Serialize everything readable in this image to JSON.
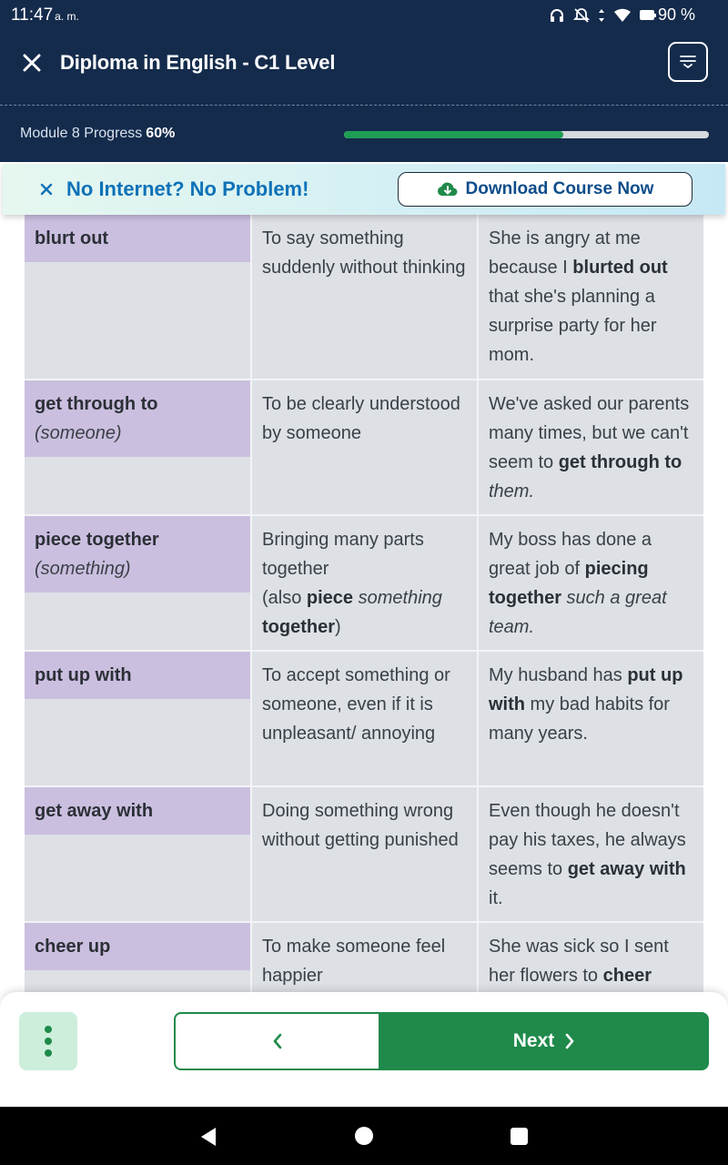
{
  "status_bar": {
    "time": "11:47",
    "ampm": "a. m.",
    "battery": "90 %"
  },
  "header": {
    "course_title": "Diploma in English - C1 Level",
    "progress_label": "Module 8 Progress",
    "progress_percent_text": "60%",
    "progress_value": 0.6
  },
  "banner": {
    "message": "No Internet? No Problem!",
    "download_label": "Download Course Now"
  },
  "table": {
    "rows": [
      {
        "term": "blurt out",
        "term_sub": "",
        "definition": [
          {
            "t": "To say something suddenly without thinking"
          }
        ],
        "example": [
          {
            "t": "She is angry at me because I "
          },
          {
            "t": "blurted out",
            "b": true
          },
          {
            "t": " that she's planning a surprise party for her mom."
          }
        ]
      },
      {
        "term": "get through to",
        "term_sub": "(someone)",
        "definition": [
          {
            "t": "To be clearly understood by someone"
          }
        ],
        "example": [
          {
            "t": "We've asked our parents many times, but we can't seem to "
          },
          {
            "t": "get through to",
            "b": true
          },
          {
            "t": " them.",
            "i": true
          }
        ]
      },
      {
        "term": "piece together",
        "term_sub": "(something)",
        "definition": [
          {
            "t": "Bringing many parts together"
          },
          {
            "br": true
          },
          {
            "t": "(also "
          },
          {
            "t": "piece",
            "b": true
          },
          {
            "t": " something",
            "i": true
          },
          {
            "t": " together",
            "b": true
          },
          {
            "t": ")"
          }
        ],
        "example": [
          {
            "t": "My boss has done a great job of "
          },
          {
            "t": "piecing together",
            "b": true
          },
          {
            "t": " such a great team.",
            "i": true
          }
        ]
      },
      {
        "term": "put up with",
        "term_sub": "",
        "definition": [
          {
            "t": "To accept something or someone, even if it is unpleasant/ annoying"
          }
        ],
        "example": [
          {
            "t": "My husband has "
          },
          {
            "t": "put up with",
            "b": true
          },
          {
            "t": " my bad habits for many years."
          }
        ]
      },
      {
        "term": "get away with",
        "term_sub": "",
        "definition": [
          {
            "t": "Doing something wrong without getting punished"
          }
        ],
        "example": [
          {
            "t": "Even though he doesn't pay his taxes, he always seems to "
          },
          {
            "t": "get away with",
            "b": true
          },
          {
            "t": " it."
          }
        ]
      },
      {
        "term": "cheer up",
        "term_sub": "",
        "definition": [
          {
            "t": "To make someone feel happier"
          }
        ],
        "example": [
          {
            "t": "She was sick so I sent her flowers to "
          },
          {
            "t": "cheer",
            "b": true
          }
        ]
      }
    ]
  },
  "bottom_nav": {
    "next_label": "Next"
  },
  "colors": {
    "header_bg": "#142b4c",
    "accent_green": "#1f8a4a",
    "progress_green": "#1f9d55",
    "term_cell_bg": "#cbbfdf",
    "table_cell_bg": "#dde0e5",
    "banner_text": "#0e72b8"
  },
  "icons": {
    "close": "close-icon",
    "menu": "menu-icon",
    "download": "cloud-download-icon",
    "prev": "chevron-left-icon",
    "next": "chevron-right-icon",
    "more": "more-vertical-icon"
  }
}
